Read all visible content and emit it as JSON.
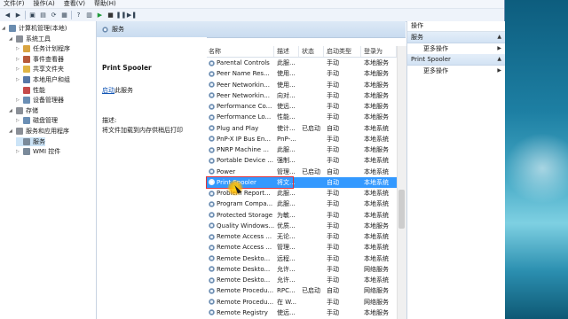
{
  "menu": [
    "文件(F)",
    "操作(A)",
    "查看(V)",
    "帮助(H)"
  ],
  "toolbar_icons": [
    "back-icon",
    "forward-icon",
    "up-icon",
    "tree-icon",
    "refresh-icon",
    "export-icon",
    "help-icon",
    "properties-icon",
    "play-icon",
    "stop-icon",
    "pause-icon",
    "restart-icon"
  ],
  "tree": [
    {
      "label": "计算机管理(本地)",
      "indent": 0,
      "icon_color": "#6a8caf"
    },
    {
      "label": "系统工具",
      "indent": 1,
      "icon_color": "#8a8f97"
    },
    {
      "label": "任务计划程序",
      "indent": 2,
      "icon_color": "#d9a441"
    },
    {
      "label": "事件查看器",
      "indent": 2,
      "icon_color": "#b85a3a"
    },
    {
      "label": "共享文件夹",
      "indent": 2,
      "icon_color": "#e0b545"
    },
    {
      "label": "本地用户和组",
      "indent": 2,
      "icon_color": "#5778a8"
    },
    {
      "label": "性能",
      "indent": 2,
      "icon_color": "#c64b4b"
    },
    {
      "label": "设备管理器",
      "indent": 2,
      "icon_color": "#6b8fb5"
    },
    {
      "label": "存储",
      "indent": 1,
      "icon_color": "#8a8f97"
    },
    {
      "label": "磁盘管理",
      "indent": 2,
      "icon_color": "#6b8fb5"
    },
    {
      "label": "服务和应用程序",
      "indent": 1,
      "icon_color": "#8a8f97"
    },
    {
      "label": "服务",
      "indent": 2,
      "icon_color": "#7a8a9a",
      "selected": true
    },
    {
      "label": "WMI 控件",
      "indent": 2,
      "icon_color": "#7a8a9a"
    }
  ],
  "mid_header": "服务",
  "details": {
    "title": "Print Spooler",
    "link_text": "启动",
    "link_suffix": "此服务",
    "desc_label": "描述:",
    "desc_text": "将文件加载到内存供稍后打印"
  },
  "columns": [
    "名称",
    "描述",
    "状态",
    "启动类型",
    "登录为"
  ],
  "services": [
    {
      "name": "Parental Controls",
      "desc": "此服...",
      "status": "",
      "startup": "手动",
      "logon": "本地服务"
    },
    {
      "name": "Peer Name Res...",
      "desc": "使用...",
      "status": "",
      "startup": "手动",
      "logon": "本地服务"
    },
    {
      "name": "Peer Networkin...",
      "desc": "使用...",
      "status": "",
      "startup": "手动",
      "logon": "本地服务"
    },
    {
      "name": "Peer Networkin...",
      "desc": "向对...",
      "status": "",
      "startup": "手动",
      "logon": "本地服务"
    },
    {
      "name": "Performance Co...",
      "desc": "使远...",
      "status": "",
      "startup": "手动",
      "logon": "本地服务"
    },
    {
      "name": "Performance Lo...",
      "desc": "性能...",
      "status": "",
      "startup": "手动",
      "logon": "本地服务"
    },
    {
      "name": "Plug and Play",
      "desc": "使计...",
      "status": "已启动",
      "startup": "自动",
      "logon": "本地系统"
    },
    {
      "name": "PnP-X IP Bus En...",
      "desc": "PnP-...",
      "status": "",
      "startup": "手动",
      "logon": "本地系统"
    },
    {
      "name": "PNRP Machine ...",
      "desc": "此服...",
      "status": "",
      "startup": "手动",
      "logon": "本地服务"
    },
    {
      "name": "Portable Device ...",
      "desc": "强制...",
      "status": "",
      "startup": "手动",
      "logon": "本地系统"
    },
    {
      "name": "Power",
      "desc": "管理...",
      "status": "已启动",
      "startup": "自动",
      "logon": "本地系统"
    },
    {
      "name": "Print Spooler",
      "desc": "将文...",
      "status": "",
      "startup": "自动",
      "logon": "本地系统",
      "selected": true
    },
    {
      "name": "Problem Report...",
      "desc": "此服...",
      "status": "",
      "startup": "手动",
      "logon": "本地系统"
    },
    {
      "name": "Program Compa...",
      "desc": "此服...",
      "status": "",
      "startup": "手动",
      "logon": "本地系统"
    },
    {
      "name": "Protected Storage",
      "desc": "为敏...",
      "status": "",
      "startup": "手动",
      "logon": "本地系统"
    },
    {
      "name": "Quality Windows...",
      "desc": "优质...",
      "status": "",
      "startup": "手动",
      "logon": "本地服务"
    },
    {
      "name": "Remote Access ...",
      "desc": "无论...",
      "status": "",
      "startup": "手动",
      "logon": "本地系统"
    },
    {
      "name": "Remote Access ...",
      "desc": "管理...",
      "status": "",
      "startup": "手动",
      "logon": "本地系统"
    },
    {
      "name": "Remote Deskto...",
      "desc": "远程...",
      "status": "",
      "startup": "手动",
      "logon": "本地系统"
    },
    {
      "name": "Remote Deskto...",
      "desc": "允许...",
      "status": "",
      "startup": "手动",
      "logon": "网络服务"
    },
    {
      "name": "Remote Deskto...",
      "desc": "允许...",
      "status": "",
      "startup": "手动",
      "logon": "本地系统"
    },
    {
      "name": "Remote Procedu...",
      "desc": "RPC...",
      "status": "已启动",
      "startup": "自动",
      "logon": "网络服务"
    },
    {
      "name": "Remote Procedu...",
      "desc": "在 W...",
      "status": "",
      "startup": "手动",
      "logon": "网络服务"
    },
    {
      "name": "Remote Registry",
      "desc": "使远...",
      "status": "",
      "startup": "手动",
      "logon": "本地服务"
    }
  ],
  "actions": {
    "header": "操作",
    "sections": [
      {
        "title": "服务",
        "items": [
          "更多操作"
        ]
      },
      {
        "title": "Print Spooler",
        "items": [
          "更多操作"
        ]
      }
    ]
  }
}
